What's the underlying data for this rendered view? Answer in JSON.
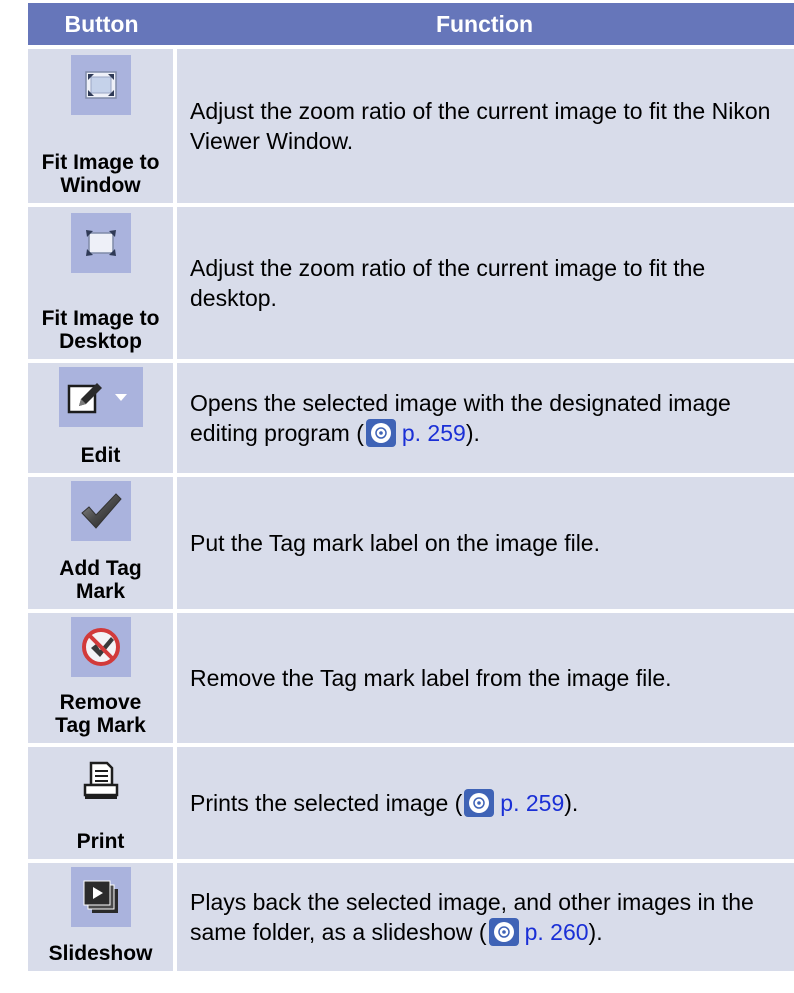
{
  "header": {
    "button": "Button",
    "function": "Function"
  },
  "rows": [
    {
      "label": "Fit Image to\nWindow",
      "icon": "fit-window-icon",
      "desc": "Adjust the zoom ratio of the current image to fit the Nikon Viewer Window."
    },
    {
      "label": "Fit Image to\nDesktop",
      "icon": "fit-desktop-icon",
      "desc": "Adjust the zoom ratio of the current image to fit the desktop."
    },
    {
      "label": "Edit",
      "icon": "edit-icon",
      "desc_pre": "Opens the selected image with the designated image editing program (",
      "link": "p. 259",
      "desc_post": ")."
    },
    {
      "label": "Add Tag\nMark",
      "icon": "checkmark-icon",
      "desc": "Put the Tag mark label on the image file."
    },
    {
      "label": "Remove\nTag Mark",
      "icon": "remove-tag-icon",
      "desc": "Remove the Tag mark label from the image file."
    },
    {
      "label": "Print",
      "icon": "print-icon",
      "desc_pre": "Prints the selected image (",
      "link": "p. 259",
      "desc_post": ")."
    },
    {
      "label": "Slideshow",
      "icon": "slideshow-icon",
      "desc_pre": "Plays back the selected image, and other images in the same folder, as a slideshow (",
      "link": "p. 260",
      "desc_post": ")."
    }
  ]
}
